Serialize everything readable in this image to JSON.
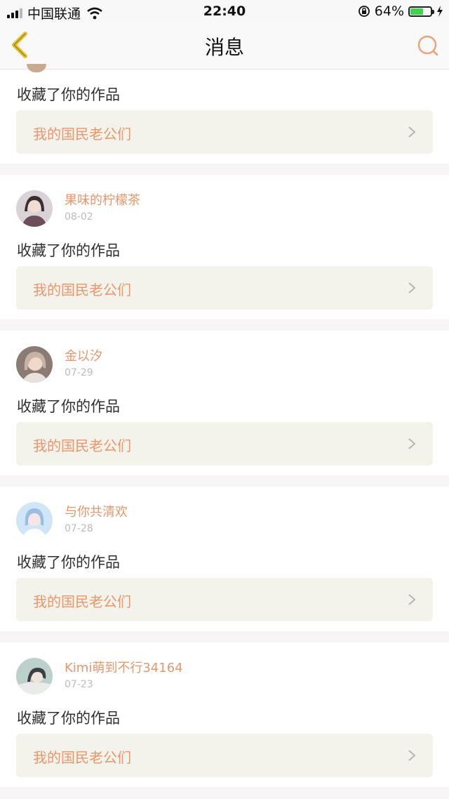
{
  "status_bar": {
    "carrier": "中国联通",
    "time": "22:40",
    "battery_percent": "64%"
  },
  "header": {
    "title": "消息",
    "back_icon": "chevron-left-icon",
    "search_icon": "search-icon"
  },
  "colors": {
    "accent": "#e8966a",
    "back_yellow": "#e9c02a",
    "link_bg": "#f3f3ec"
  },
  "notifications": [
    {
      "action": "收藏了你的作品",
      "work_title": "我的国民老公们"
    },
    {
      "user": "果味的柠檬茶",
      "date": "08-02",
      "action": "收藏了你的作品",
      "work_title": "我的国民老公们"
    },
    {
      "user": "金以汐",
      "date": "07-29",
      "action": "收藏了你的作品",
      "work_title": "我的国民老公们"
    },
    {
      "user": "与你共清欢",
      "date": "07-28",
      "action": "收藏了你的作品",
      "work_title": "我的国民老公们"
    },
    {
      "user": "Kimi萌到不行34164",
      "date": "07-23",
      "action": "收藏了你的作品",
      "work_title": "我的国民老公们"
    }
  ]
}
